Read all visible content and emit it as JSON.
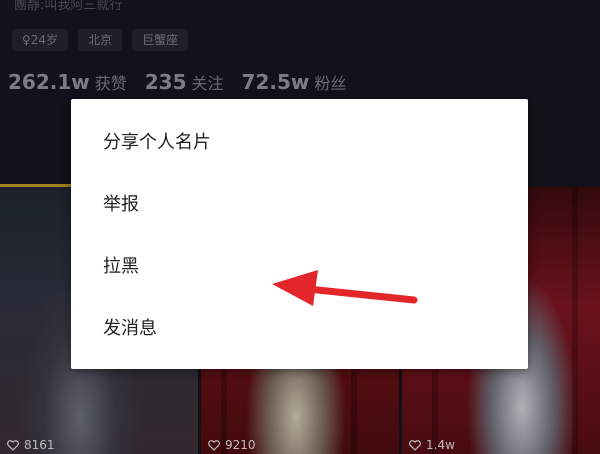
{
  "profile": {
    "bio": "團靜:叫我阿三就行",
    "tags": [
      {
        "label": "♀24岁"
      },
      {
        "label": "北京"
      },
      {
        "label": "巨蟹座"
      }
    ],
    "stats": [
      {
        "value": "262.1w",
        "label": "获赞"
      },
      {
        "value": "235",
        "label": "关注"
      },
      {
        "value": "72.5w",
        "label": "粉丝"
      }
    ]
  },
  "videos": [
    {
      "likes": "8161"
    },
    {
      "likes": "9210"
    },
    {
      "likes": "1.4w"
    }
  ],
  "menu": {
    "items": [
      {
        "label": "分享个人名片"
      },
      {
        "label": "举报"
      },
      {
        "label": "拉黑"
      },
      {
        "label": "发消息"
      }
    ]
  },
  "colors": {
    "background": "#15131c",
    "menu_background": "#ffffff",
    "annotation_arrow": "#e3262a",
    "tab_indicator": "#b8961c"
  },
  "icons": {
    "likes": "heart-outline-icon"
  }
}
